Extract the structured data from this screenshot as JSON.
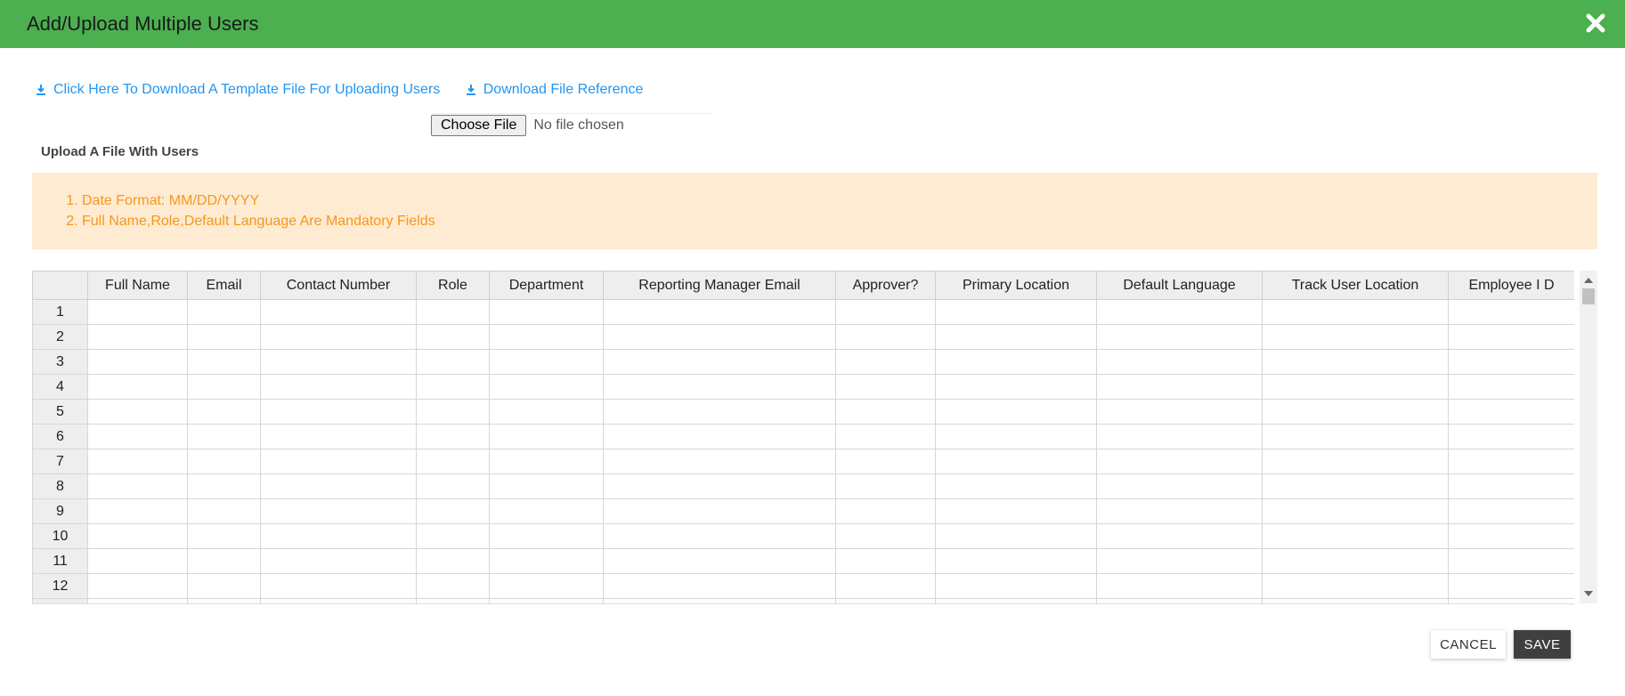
{
  "header": {
    "title": "Add/Upload Multiple Users",
    "close_icon": "close-icon"
  },
  "links": {
    "download_template": "Click Here To Download A Template File For Uploading Users",
    "download_reference": "Download File Reference",
    "icon": "download-icon"
  },
  "file_input": {
    "button_label": "Choose File",
    "status": "No file chosen"
  },
  "upload_label": "Upload A File With Users",
  "notes": [
    "Date Format: MM/DD/YYYY",
    "Full Name,Role,Default Language Are Mandatory Fields"
  ],
  "grid": {
    "columns": [
      "",
      "Full Name",
      "Email",
      "Contact Number",
      "Role",
      "Department",
      "Reporting Manager Email",
      "Approver?",
      "Primary Location",
      "Default Language",
      "Track User Location",
      "Employee I D"
    ],
    "rows": [
      "1",
      "2",
      "3",
      "4",
      "5",
      "6",
      "7",
      "8",
      "9",
      "10",
      "11",
      "12"
    ]
  },
  "footer": {
    "cancel": "CANCEL",
    "save": "SAVE"
  },
  "colors": {
    "header": "#4caf50",
    "link": "#2196f3",
    "notes_bg": "#ffebd2",
    "notes_text": "#f5971b",
    "save_bg": "#3f3f3f"
  }
}
